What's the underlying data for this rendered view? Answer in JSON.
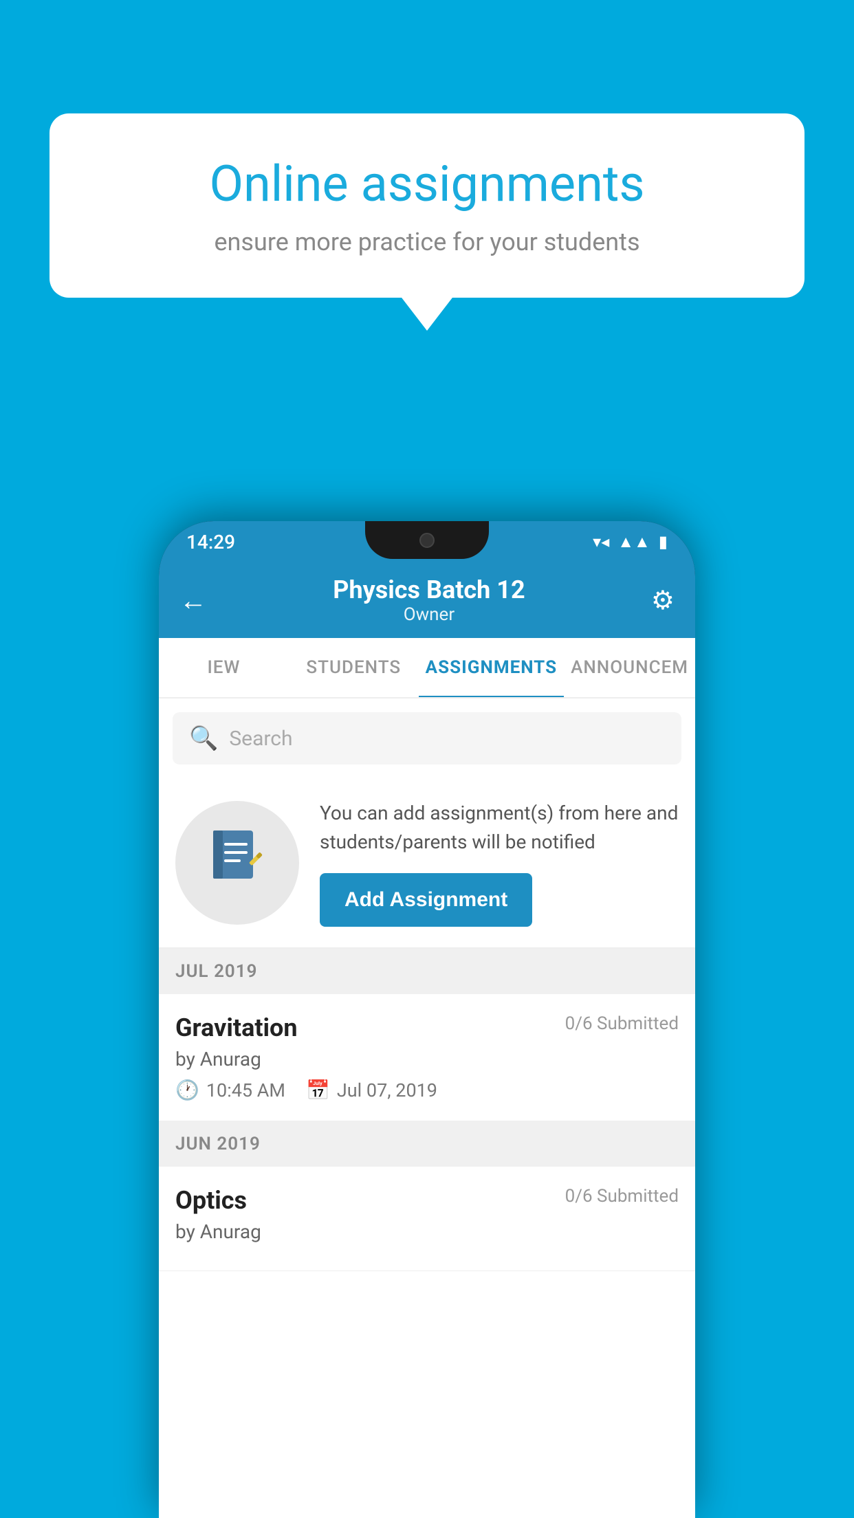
{
  "background_color": "#00AADD",
  "speech_bubble": {
    "title": "Online assignments",
    "subtitle": "ensure more practice for your students"
  },
  "phone": {
    "status_bar": {
      "time": "14:29",
      "icons": [
        "wifi",
        "signal",
        "battery"
      ]
    },
    "header": {
      "back_icon": "←",
      "title": "Physics Batch 12",
      "subtitle": "Owner",
      "gear_icon": "⚙"
    },
    "tabs": [
      {
        "label": "IEW",
        "active": false
      },
      {
        "label": "STUDENTS",
        "active": false
      },
      {
        "label": "ASSIGNMENTS",
        "active": true
      },
      {
        "label": "ANNOUNCEM",
        "active": false
      }
    ],
    "search": {
      "placeholder": "Search",
      "icon": "🔍"
    },
    "promo": {
      "icon": "📓",
      "text": "You can add assignment(s) from here and students/parents will be notified",
      "button_label": "Add Assignment"
    },
    "assignment_groups": [
      {
        "month_label": "JUL 2019",
        "assignments": [
          {
            "name": "Gravitation",
            "submitted": "0/6 Submitted",
            "by": "by Anurag",
            "time": "10:45 AM",
            "date": "Jul 07, 2019"
          }
        ]
      },
      {
        "month_label": "JUN 2019",
        "assignments": [
          {
            "name": "Optics",
            "submitted": "0/6 Submitted",
            "by": "by Anurag",
            "time": "",
            "date": ""
          }
        ]
      }
    ]
  }
}
